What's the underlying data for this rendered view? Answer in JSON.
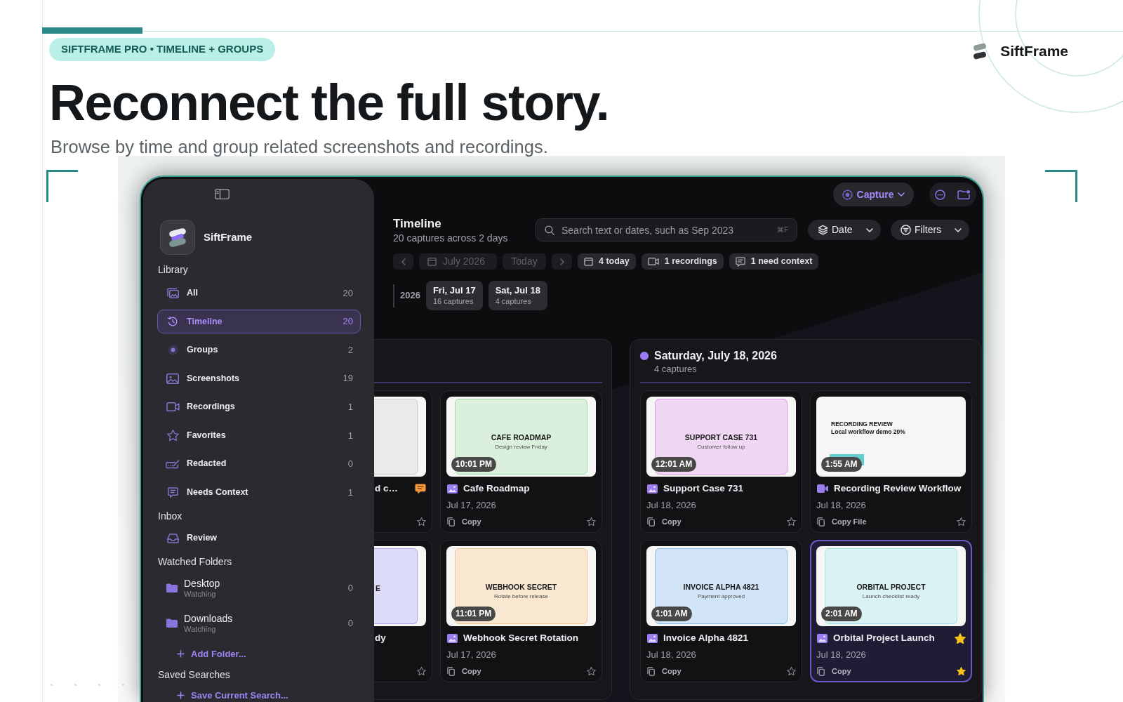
{
  "hero": {
    "badge": "SIFTFRAME PRO • TIMELINE + GROUPS",
    "brand": "SiftFrame",
    "title": "Reconnect the full story.",
    "subtitle": "Browse by time and group related screenshots and recordings."
  },
  "sidebar": {
    "app_name": "SiftFrame",
    "sections": [
      {
        "title": "Library",
        "items": [
          {
            "label": "All",
            "count": "20",
            "selected": false
          },
          {
            "label": "Timeline",
            "count": "20",
            "selected": true
          },
          {
            "label": "Groups",
            "count": "2",
            "selected": false
          },
          {
            "label": "Screenshots",
            "count": "19",
            "selected": false
          },
          {
            "label": "Recordings",
            "count": "1",
            "selected": false
          },
          {
            "label": "Favorites",
            "count": "1",
            "selected": false
          },
          {
            "label": "Redacted",
            "count": "0",
            "selected": false
          },
          {
            "label": "Needs Context",
            "count": "1",
            "selected": false
          }
        ]
      },
      {
        "title": "Inbox",
        "items": [
          {
            "label": "Review",
            "selected": false
          }
        ]
      },
      {
        "title": "Watched Folders",
        "items": [
          {
            "label": "Desktop",
            "detail": "Watching",
            "count": "0",
            "selected": false
          },
          {
            "label": "Downloads",
            "detail": "Watching",
            "count": "0",
            "selected": false
          }
        ],
        "action": "Add Folder..."
      },
      {
        "title": "Saved Searches",
        "action": "Save Current Search..."
      }
    ]
  },
  "toolbar": {
    "capture": "Capture",
    "title": "Timeline",
    "subtitle": "20 captures across 2 days",
    "search": {
      "placeholder": "Search text or dates, such as Sep 2023",
      "shortcut": "⌘F"
    },
    "sort": "Date",
    "filter": "Filters"
  },
  "navigation": [
    {
      "kind": "previous",
      "disabled": true
    },
    {
      "kind": "month",
      "label": "July 2026",
      "disabled": true
    },
    {
      "kind": "today",
      "label": "Today",
      "disabled": true
    },
    {
      "kind": "next",
      "disabled": true
    }
  ],
  "summary_chips": [
    {
      "label": "4 today"
    },
    {
      "label": "1 recordings"
    },
    {
      "label": "1 need context"
    }
  ],
  "day_jump": {
    "year": "2026",
    "days": [
      {
        "label": "Fri, Jul 17",
        "count": "16 captures"
      },
      {
        "label": "Sat, Jul 18",
        "count": "4 captures"
      }
    ]
  },
  "day_groups": [
    {
      "rows": [
        {
          "cards": [
            {
              "kind": "clipped",
              "title": "d c…",
              "needs_context": true,
              "favorite": false,
              "selected": false,
              "thumbnail": {
                "kind": "document",
                "color": "#cbcbcb"
              }
            },
            {
              "kind": "screenshot",
              "time": "10:01 PM",
              "title": "Cafe Roadmap",
              "date": "Jul 17, 2026",
              "action": "Copy",
              "needs_context": false,
              "favorite": false,
              "selected": false,
              "thumbnail": {
                "kind": "document",
                "title": "CAFE ROADMAP",
                "subtitle": "Design review Friday",
                "color": "#a3d9a9"
              }
            }
          ]
        },
        {
          "cards": [
            {
              "kind": "clipped",
              "title": "dy",
              "needs_context": false,
              "favorite": false,
              "selected": false,
              "thumbnail": {
                "kind": "document",
                "title": "E",
                "color": "#a9a8ee"
              }
            },
            {
              "kind": "screenshot",
              "time": "11:01 PM",
              "title": "Webhook Secret Rotation",
              "date": "Jul 17, 2026",
              "action": "Copy",
              "needs_context": false,
              "favorite": false,
              "selected": false,
              "thumbnail": {
                "kind": "document",
                "title": "WEBHOOK SECRET",
                "subtitle": "Rotate before release",
                "color": "#f0c28e"
              }
            }
          ]
        }
      ]
    },
    {
      "title": "Saturday, July 18, 2026",
      "count": "4 captures",
      "rows": [
        {
          "cards": [
            {
              "kind": "screenshot",
              "time": "12:01 AM",
              "title": "Support Case 731",
              "date": "Jul 18, 2026",
              "action": "Copy",
              "needs_context": false,
              "favorite": false,
              "selected": false,
              "thumbnail": {
                "kind": "document",
                "title": "SUPPORT CASE 731",
                "subtitle": "Customer follow up",
                "color": "#d99be3"
              }
            },
            {
              "kind": "recording",
              "time": "1:55 AM",
              "title": "Recording Review Workflow",
              "date": "Jul 18, 2026",
              "action": "Copy File",
              "needs_context": false,
              "favorite": false,
              "selected": false,
              "thumbnail": {
                "kind": "frame",
                "title": "RECORDING REVIEW",
                "subtitle": "Local workflow demo 20%"
              }
            }
          ]
        },
        {
          "cards": [
            {
              "kind": "screenshot",
              "time": "1:01 AM",
              "title": "Invoice Alpha 4821",
              "date": "Jul 18, 2026",
              "action": "Copy",
              "needs_context": false,
              "favorite": false,
              "selected": false,
              "thumbnail": {
                "kind": "document",
                "title": "INVOICE ALPHA 4821",
                "subtitle": "Payment approved",
                "color": "#8cbde8"
              }
            },
            {
              "kind": "screenshot",
              "time": "2:01 AM",
              "title": "Orbital Project Launch",
              "date": "Jul 18, 2026",
              "action": "Copy",
              "needs_context": false,
              "favorite": true,
              "selected": true,
              "thumbnail": {
                "kind": "document",
                "title": "ORBITAL PROJECT",
                "subtitle": "Launch checklist ready",
                "color": "#9fe0e4"
              }
            }
          ]
        }
      ]
    }
  ]
}
